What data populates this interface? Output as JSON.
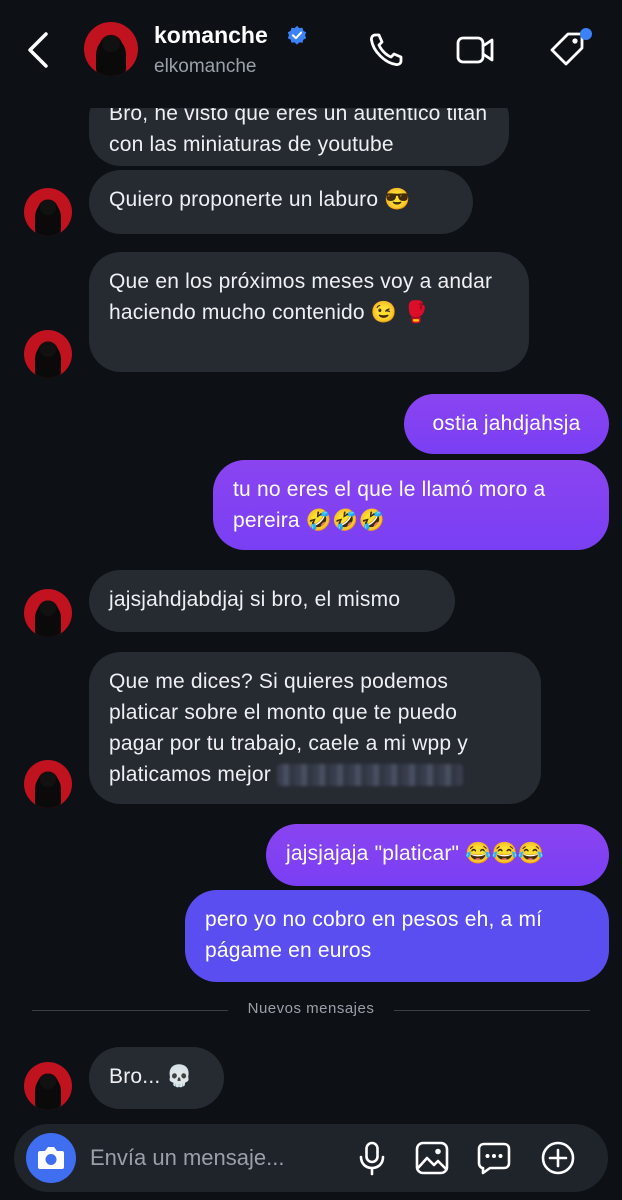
{
  "header": {
    "name": "komanche",
    "username": "elkomanche",
    "icons": [
      "back-arrow-icon",
      "verified-badge-icon",
      "phone-icon",
      "video-camera-icon",
      "tag-icon"
    ]
  },
  "messages": [
    {
      "from": "them",
      "text": "Bro, he visto que eres un auténtico titán con las miniaturas de youtube"
    },
    {
      "from": "them",
      "text": "Quiero proponerte un laburo 😎"
    },
    {
      "from": "them",
      "text": "Que en los próximos meses voy a andar haciendo mucho contenido 😉 🥊"
    },
    {
      "from": "me",
      "text": "ostia jahdjahsja"
    },
    {
      "from": "me",
      "text": "tu no eres el que le llamó moro a pereira 🤣🤣🤣"
    },
    {
      "from": "them",
      "text": "jajsjahdjabdjaj si bro, el mismo"
    },
    {
      "from": "them",
      "text_line1": "Que me dices? Si quieres podemos",
      "text_line2": "platicar sobre el monto que te puedo",
      "text_line3": "pagar por tu trabajo, caele a mi wpp y",
      "text_line4": "platicamos mejor"
    },
    {
      "from": "me",
      "text": "jajsjajaja \"platicar\" 😂😂😂"
    },
    {
      "from": "me",
      "text": "pero yo no cobro en pesos eh, a mí págame en euros"
    },
    {
      "from": "them",
      "text": "Bro... 💀"
    }
  ],
  "divider": {
    "label": "Nuevos mensajes"
  },
  "composer": {
    "placeholder": "Envía un mensaje..."
  },
  "colors": {
    "background": "#0d1116",
    "incoming": "#262a31",
    "outgoing": "#7a3ff4",
    "accent": "#3b82f6"
  }
}
